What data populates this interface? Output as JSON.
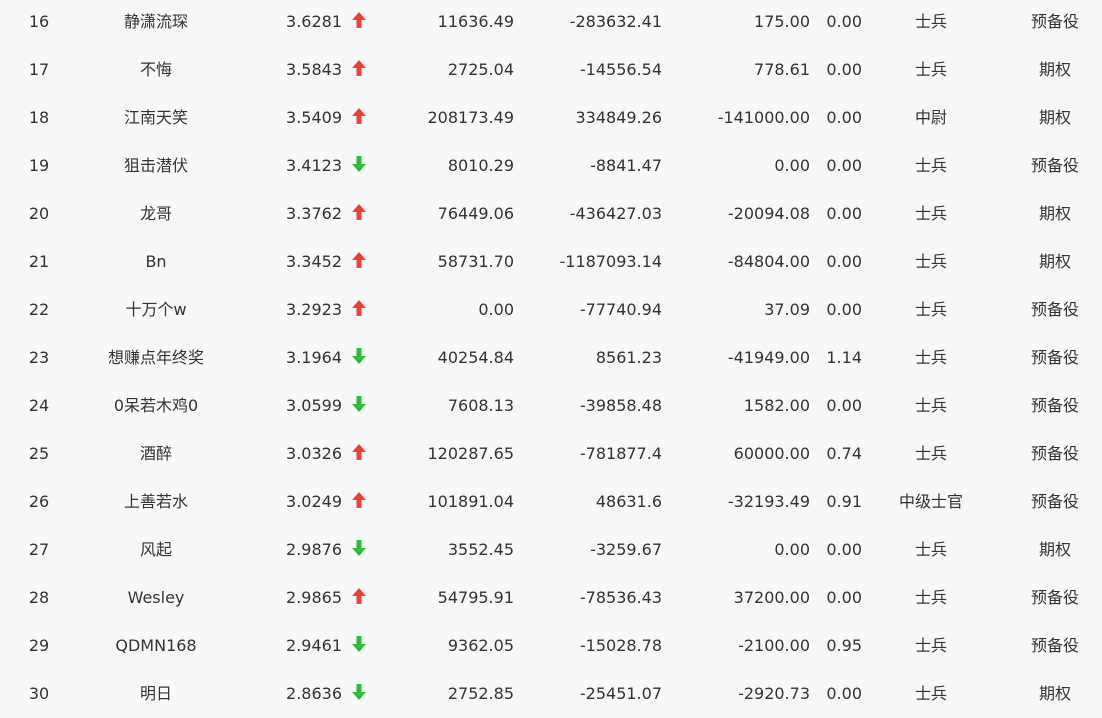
{
  "colors": {
    "up": "#f23c3c",
    "down": "#2bbf37",
    "text": "#333333",
    "background": "#f7f8fa"
  },
  "rows": [
    {
      "rank": "16",
      "name": "静潇流琛",
      "score": "3.6281",
      "trend": "up",
      "v1": "11636.49",
      "v2": "-283632.41",
      "v3": "175.00",
      "v4": "0.00",
      "level": "士兵",
      "type": "预备役"
    },
    {
      "rank": "17",
      "name": "不悔",
      "score": "3.5843",
      "trend": "up",
      "v1": "2725.04",
      "v2": "-14556.54",
      "v3": "778.61",
      "v4": "0.00",
      "level": "士兵",
      "type": "期权"
    },
    {
      "rank": "18",
      "name": "江南天笑",
      "score": "3.5409",
      "trend": "up",
      "v1": "208173.49",
      "v2": "334849.26",
      "v3": "-141000.00",
      "v4": "0.00",
      "level": "中尉",
      "type": "期权"
    },
    {
      "rank": "19",
      "name": "狙击潜伏",
      "score": "3.4123",
      "trend": "down",
      "v1": "8010.29",
      "v2": "-8841.47",
      "v3": "0.00",
      "v4": "0.00",
      "level": "士兵",
      "type": "预备役"
    },
    {
      "rank": "20",
      "name": "龙哥",
      "score": "3.3762",
      "trend": "up",
      "v1": "76449.06",
      "v2": "-436427.03",
      "v3": "-20094.08",
      "v4": "0.00",
      "level": "士兵",
      "type": "期权"
    },
    {
      "rank": "21",
      "name": "Bn",
      "score": "3.3452",
      "trend": "up",
      "v1": "58731.70",
      "v2": "-1187093.14",
      "v3": "-84804.00",
      "v4": "0.00",
      "level": "士兵",
      "type": "期权"
    },
    {
      "rank": "22",
      "name": "十万个w",
      "score": "3.2923",
      "trend": "up",
      "v1": "0.00",
      "v2": "-77740.94",
      "v3": "37.09",
      "v4": "0.00",
      "level": "士兵",
      "type": "预备役"
    },
    {
      "rank": "23",
      "name": "想赚点年终奖",
      "score": "3.1964",
      "trend": "down",
      "v1": "40254.84",
      "v2": "8561.23",
      "v3": "-41949.00",
      "v4": "1.14",
      "level": "士兵",
      "type": "预备役"
    },
    {
      "rank": "24",
      "name": "0呆若木鸡0",
      "score": "3.0599",
      "trend": "down",
      "v1": "7608.13",
      "v2": "-39858.48",
      "v3": "1582.00",
      "v4": "0.00",
      "level": "士兵",
      "type": "预备役"
    },
    {
      "rank": "25",
      "name": "酒醉",
      "score": "3.0326",
      "trend": "up",
      "v1": "120287.65",
      "v2": "-781877.4",
      "v3": "60000.00",
      "v4": "0.74",
      "level": "士兵",
      "type": "预备役"
    },
    {
      "rank": "26",
      "name": "上善若水",
      "score": "3.0249",
      "trend": "up",
      "v1": "101891.04",
      "v2": "48631.6",
      "v3": "-32193.49",
      "v4": "0.91",
      "level": "中级士官",
      "type": "预备役"
    },
    {
      "rank": "27",
      "name": "风起",
      "score": "2.9876",
      "trend": "down",
      "v1": "3552.45",
      "v2": "-3259.67",
      "v3": "0.00",
      "v4": "0.00",
      "level": "士兵",
      "type": "期权"
    },
    {
      "rank": "28",
      "name": "Wesley",
      "score": "2.9865",
      "trend": "up",
      "v1": "54795.91",
      "v2": "-78536.43",
      "v3": "37200.00",
      "v4": "0.00",
      "level": "士兵",
      "type": "预备役"
    },
    {
      "rank": "29",
      "name": "QDMN168",
      "score": "2.9461",
      "trend": "down",
      "v1": "9362.05",
      "v2": "-15028.78",
      "v3": "-2100.00",
      "v4": "0.95",
      "level": "士兵",
      "type": "预备役"
    },
    {
      "rank": "30",
      "name": "明日",
      "score": "2.8636",
      "trend": "down",
      "v1": "2752.85",
      "v2": "-25451.07",
      "v3": "-2920.73",
      "v4": "0.00",
      "level": "士兵",
      "type": "期权"
    }
  ]
}
